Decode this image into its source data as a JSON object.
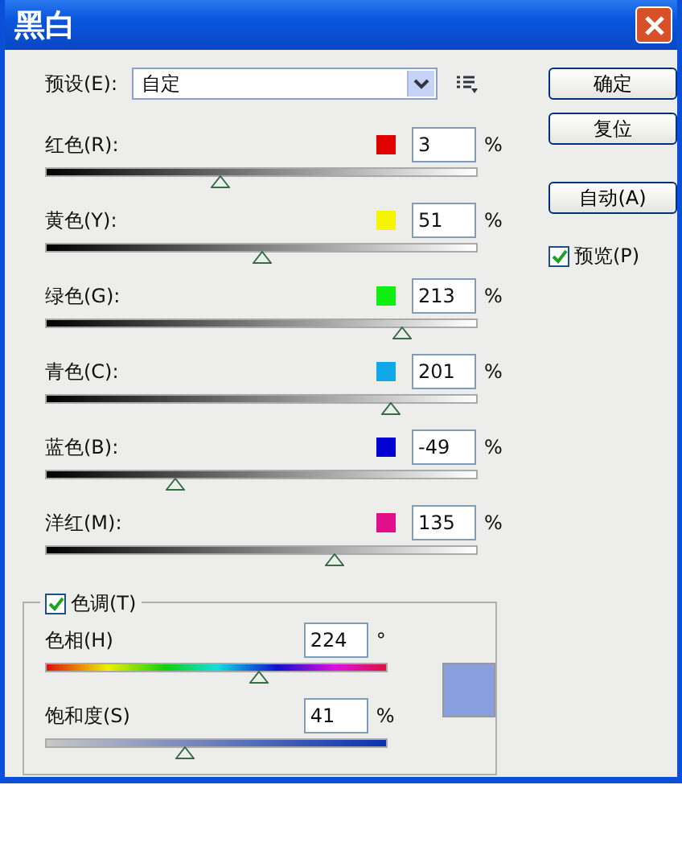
{
  "window": {
    "title": "黑白"
  },
  "preset": {
    "label": "预设(E):",
    "value": "自定"
  },
  "channels": [
    {
      "label": "红色(R):",
      "color": "#e00000",
      "value": "3",
      "unit": "%",
      "level": 0.405
    },
    {
      "label": "黄色(Y):",
      "color": "#f5f500",
      "value": "51",
      "unit": "%",
      "level": 0.5
    },
    {
      "label": "绿色(G):",
      "color": "#10ee10",
      "value": "213",
      "unit": "%",
      "level": 0.825
    },
    {
      "label": "青色(C):",
      "color": "#10a8e8",
      "value": "201",
      "unit": "%",
      "level": 0.8
    },
    {
      "label": "蓝色(B):",
      "color": "#0000d0",
      "value": "-49",
      "unit": "%",
      "level": 0.3
    },
    {
      "label": "洋红(M):",
      "color": "#e0108a",
      "value": "135",
      "unit": "%",
      "level": 0.67
    }
  ],
  "tint": {
    "label": "色调(T)",
    "checked": true,
    "color": "#8a9fde",
    "hue": {
      "label": "色相(H)",
      "value": "224",
      "unit": "°",
      "level": 0.625
    },
    "saturation": {
      "label": "饱和度(S)",
      "value": "41",
      "unit": "%",
      "level": 0.41
    }
  },
  "buttons": [
    "确定",
    "复位",
    "自动(A)"
  ],
  "preview": {
    "label": "预览(P)",
    "checked": true
  }
}
